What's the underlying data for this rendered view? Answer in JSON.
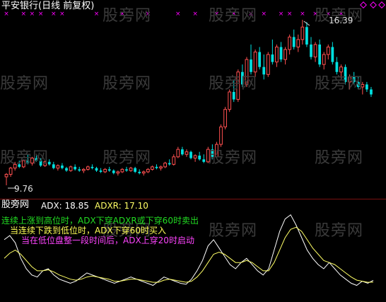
{
  "watermark": "股旁网",
  "main_panel": {
    "title": "平安银行(日线 前复权)",
    "max_label": "16.39",
    "min_label": "9.76",
    "colors": {
      "up": "#ff5050",
      "down": "#00e0e0",
      "marker": "#ff00ff",
      "diamond": "#ff00ff",
      "title": "#ffffff"
    }
  },
  "indicator_panel": {
    "name": "股旁网",
    "adx_label": "ADX: 18.85",
    "adxr_label": "ADXR: 17.10",
    "notes": [
      {
        "text": "连续上涨到高位时，ADX下穿ADXR或下穿60时卖出",
        "color": "#22dd22"
      },
      {
        "text": "当连续下跌到低位时，ADX下穿60时买入",
        "color": "#ffff55"
      },
      {
        "text": "当在低位盘整一段时间后，ADX上穿20时启动",
        "color": "#ff44ff"
      }
    ],
    "colors": {
      "adx": "#ffffff",
      "adxr": "#ffff66"
    }
  },
  "chart_data": {
    "type": "candlestick",
    "title": "平安银行(日线 前复权)",
    "price_range_labels": {
      "high": 16.39,
      "low": 9.76
    },
    "candles": [
      [
        10.1,
        10.25,
        9.76,
        10.2
      ],
      [
        10.2,
        10.5,
        10.1,
        10.45
      ],
      [
        10.45,
        10.7,
        10.35,
        10.6
      ],
      [
        10.6,
        10.75,
        10.45,
        10.5
      ],
      [
        10.5,
        10.8,
        10.45,
        10.75
      ],
      [
        10.75,
        11.0,
        10.6,
        10.65
      ],
      [
        10.65,
        10.9,
        10.55,
        10.85
      ],
      [
        10.85,
        10.95,
        10.7,
        10.75
      ],
      [
        10.75,
        10.85,
        10.5,
        10.55
      ],
      [
        10.55,
        10.75,
        10.5,
        10.7
      ],
      [
        10.7,
        10.8,
        10.55,
        10.6
      ],
      [
        10.6,
        10.7,
        10.4,
        10.45
      ],
      [
        10.45,
        10.6,
        10.35,
        10.55
      ],
      [
        10.55,
        10.65,
        10.4,
        10.45
      ],
      [
        10.45,
        10.5,
        10.3,
        10.35
      ],
      [
        10.35,
        10.55,
        10.3,
        10.5
      ],
      [
        10.5,
        10.6,
        10.35,
        10.4
      ],
      [
        10.4,
        10.5,
        10.3,
        10.35
      ],
      [
        10.35,
        10.45,
        10.25,
        10.4
      ],
      [
        10.4,
        10.55,
        10.35,
        10.5
      ],
      [
        10.5,
        10.6,
        10.4,
        10.45
      ],
      [
        10.45,
        10.5,
        10.3,
        10.35
      ],
      [
        10.35,
        10.45,
        10.25,
        10.3
      ],
      [
        10.3,
        10.45,
        10.25,
        10.4
      ],
      [
        10.4,
        10.5,
        10.3,
        10.35
      ],
      [
        10.35,
        10.4,
        10.2,
        10.25
      ],
      [
        10.25,
        10.35,
        10.15,
        10.3
      ],
      [
        10.3,
        10.45,
        10.25,
        10.4
      ],
      [
        10.4,
        10.5,
        10.3,
        10.35
      ],
      [
        10.35,
        10.5,
        10.3,
        10.45
      ],
      [
        10.45,
        10.5,
        10.25,
        10.3
      ],
      [
        10.3,
        10.4,
        10.2,
        10.25
      ],
      [
        10.25,
        10.35,
        10.15,
        10.3
      ],
      [
        10.3,
        10.45,
        10.25,
        10.4
      ],
      [
        10.4,
        10.55,
        10.35,
        10.5
      ],
      [
        10.5,
        10.6,
        10.4,
        10.45
      ],
      [
        10.45,
        10.55,
        10.35,
        10.5
      ],
      [
        10.5,
        10.7,
        10.45,
        10.65
      ],
      [
        10.65,
        10.8,
        10.55,
        10.6
      ],
      [
        10.6,
        11.0,
        10.55,
        10.9
      ],
      [
        10.9,
        11.3,
        10.85,
        11.2
      ],
      [
        11.2,
        11.3,
        10.95,
        11.0
      ],
      [
        11.0,
        11.2,
        10.9,
        11.1
      ],
      [
        11.1,
        11.15,
        10.8,
        10.85
      ],
      [
        10.85,
        11.0,
        10.7,
        10.95
      ],
      [
        10.95,
        11.1,
        10.75,
        10.8
      ],
      [
        10.8,
        11.0,
        10.65,
        10.7
      ],
      [
        10.7,
        11.3,
        10.65,
        11.2
      ],
      [
        11.2,
        11.4,
        10.8,
        10.9
      ],
      [
        10.9,
        11.5,
        10.85,
        11.4
      ],
      [
        11.4,
        12.2,
        11.3,
        12.1
      ],
      [
        12.1,
        12.9,
        12.0,
        12.8
      ],
      [
        12.8,
        13.6,
        12.7,
        13.5
      ],
      [
        13.5,
        14.0,
        13.1,
        13.2
      ],
      [
        13.2,
        14.4,
        13.1,
        14.3
      ],
      [
        14.3,
        14.6,
        13.7,
        13.8
      ],
      [
        13.8,
        14.9,
        13.7,
        14.8
      ],
      [
        14.8,
        15.4,
        14.2,
        14.3
      ],
      [
        14.3,
        15.2,
        14.1,
        15.1
      ],
      [
        15.1,
        15.3,
        14.4,
        14.5
      ],
      [
        14.5,
        15.0,
        14.0,
        14.2
      ],
      [
        14.2,
        15.1,
        14.1,
        15.0
      ],
      [
        15.0,
        15.6,
        14.6,
        14.7
      ],
      [
        14.7,
        15.4,
        14.5,
        15.3
      ],
      [
        15.3,
        15.5,
        14.7,
        14.8
      ],
      [
        14.8,
        15.3,
        14.6,
        15.2
      ],
      [
        15.2,
        15.8,
        15.0,
        15.7
      ],
      [
        15.7,
        16.0,
        15.2,
        15.3
      ],
      [
        15.3,
        15.8,
        15.1,
        15.6
      ],
      [
        15.6,
        16.39,
        15.4,
        16.1
      ],
      [
        16.1,
        16.3,
        15.3,
        15.4
      ],
      [
        15.4,
        15.7,
        14.8,
        14.9
      ],
      [
        14.9,
        15.5,
        14.7,
        15.4
      ],
      [
        15.4,
        15.6,
        14.5,
        14.6
      ],
      [
        14.6,
        15.1,
        14.4,
        15.0
      ],
      [
        15.0,
        15.4,
        14.8,
        15.3
      ],
      [
        15.3,
        15.5,
        14.6,
        14.7
      ],
      [
        14.7,
        14.9,
        14.2,
        14.3
      ],
      [
        14.3,
        14.6,
        14.0,
        14.5
      ],
      [
        14.5,
        14.6,
        13.8,
        13.9
      ],
      [
        13.9,
        14.2,
        13.6,
        14.1
      ],
      [
        14.1,
        14.3,
        13.8,
        13.9
      ],
      [
        13.9,
        14.1,
        13.6,
        13.7
      ],
      [
        13.7,
        13.9,
        13.4,
        13.8
      ],
      [
        13.8,
        13.9,
        13.5,
        13.6
      ],
      [
        13.6,
        13.7,
        13.3,
        13.4
      ]
    ],
    "indicator": {
      "name": "股旁网",
      "series": [
        {
          "name": "ADX",
          "values": [
            58,
            62,
            55,
            40,
            30,
            24,
            22,
            28,
            30,
            24,
            20,
            18,
            16,
            18,
            22,
            26,
            24,
            22,
            20,
            18,
            16,
            18,
            20,
            22,
            20,
            18,
            16,
            14,
            18,
            22,
            20,
            18,
            16,
            15,
            20,
            28,
            38,
            52,
            58,
            50,
            42,
            34,
            30,
            36,
            40,
            34,
            28,
            24,
            30,
            48,
            66,
            78,
            82,
            72,
            60,
            48,
            40,
            34,
            30,
            36,
            30,
            24,
            20,
            16,
            14,
            18,
            16,
            18.85
          ]
        },
        {
          "name": "ADXR",
          "values": [
            40,
            45,
            48,
            44,
            38,
            32,
            28,
            28,
            29,
            27,
            24,
            22,
            20,
            19,
            20,
            22,
            23,
            22,
            21,
            20,
            18,
            18,
            19,
            20,
            20,
            19,
            18,
            17,
            17,
            19,
            20,
            19,
            18,
            17,
            18,
            22,
            28,
            36,
            44,
            46,
            44,
            40,
            36,
            36,
            38,
            36,
            32,
            28,
            28,
            36,
            48,
            60,
            68,
            70,
            66,
            58,
            50,
            44,
            38,
            36,
            34,
            30,
            26,
            22,
            19,
            18,
            17,
            17.1
          ]
        }
      ]
    }
  }
}
